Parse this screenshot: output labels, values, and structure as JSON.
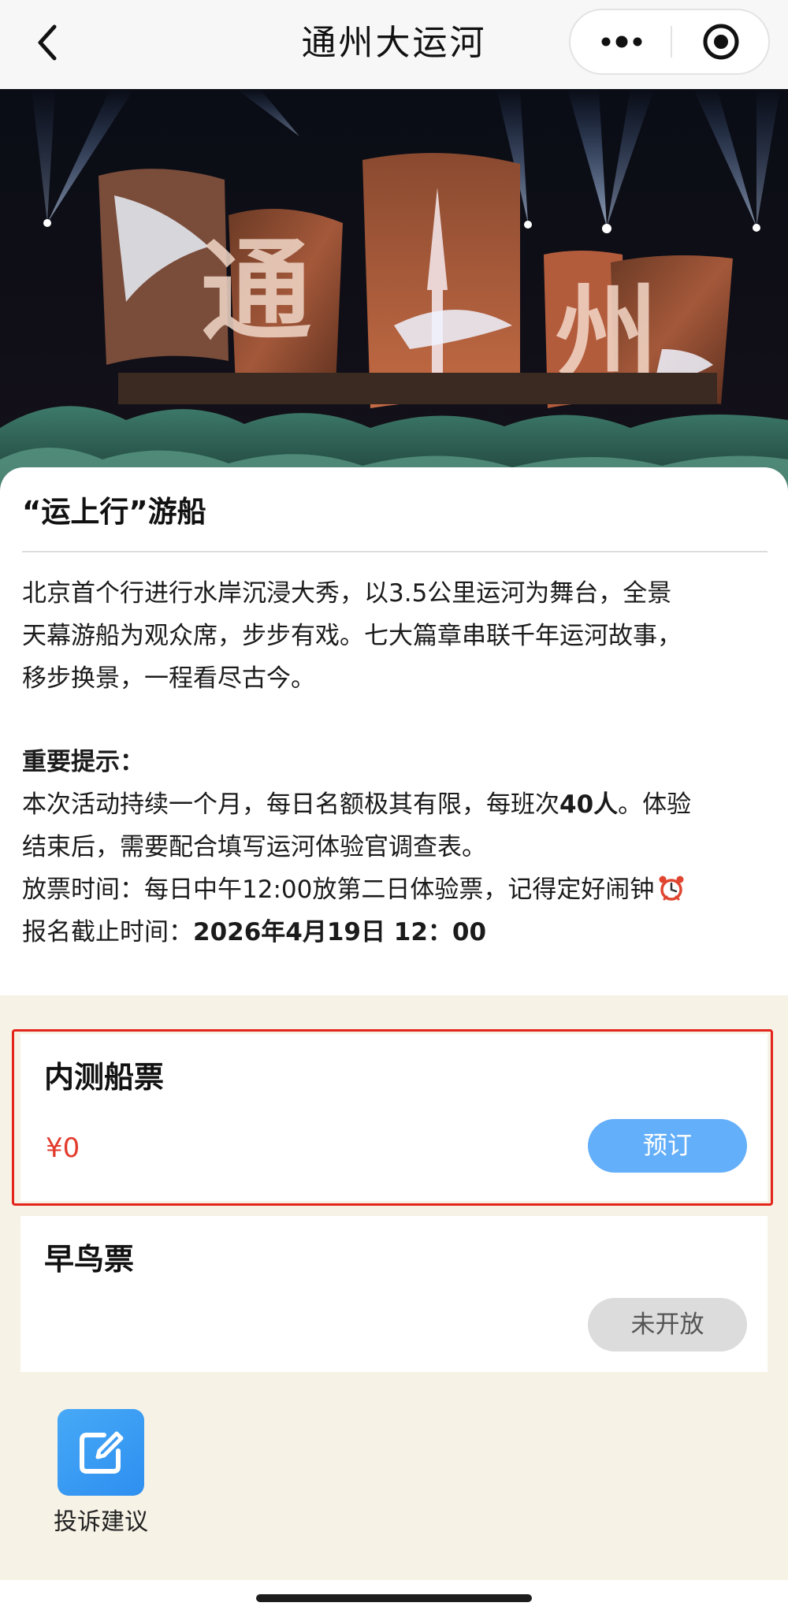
{
  "navbar": {
    "title": "通州大运河",
    "back_icon": "chevron-left-icon",
    "more_icon": "more-dots-icon",
    "close_icon": "target-close-icon"
  },
  "hero": {
    "image": "night light show of illuminated sail screens on the canal",
    "sail_characters": [
      "通",
      "州"
    ]
  },
  "event": {
    "title": "“运上行”游船",
    "description_lines": [
      "北京首个行进行水岸沉浸大秀，以3.5公里运河为舞台，全景",
      "天幕游船为观众席，步步有戏。七大篇章串联千年运河故事，",
      "移步换景，一程看尽古今。"
    ],
    "notice_title": "重要提示：",
    "notice_line1_a": "本次活动持续一个月，每日名额极其有限，每班次",
    "notice_line1_b": "40人",
    "notice_line1_c": "。体验",
    "notice_line2": "结束后，需要配合填写运河体验官调查表。",
    "release_time": "放票时间：每日中午12:00放第二日体验票，记得定好闹钟",
    "deadline_label": "报名截止时间：",
    "deadline_value": "2026年4月19日 12：00",
    "alarm_icon": "alarm-clock-icon"
  },
  "tickets": [
    {
      "name": "内测船票",
      "price": "¥0",
      "button_label": "预订",
      "available": true
    },
    {
      "name": "早鸟票",
      "price": "",
      "button_label": "未开放",
      "available": false
    }
  ],
  "complaint": {
    "label": "投诉建议",
    "icon": "edit-note-icon"
  },
  "colors": {
    "accent_blue": "#64aff9",
    "price_red": "#e23a2c",
    "highlight_red": "#e3251c",
    "page_bg": "#f6f2e6"
  }
}
